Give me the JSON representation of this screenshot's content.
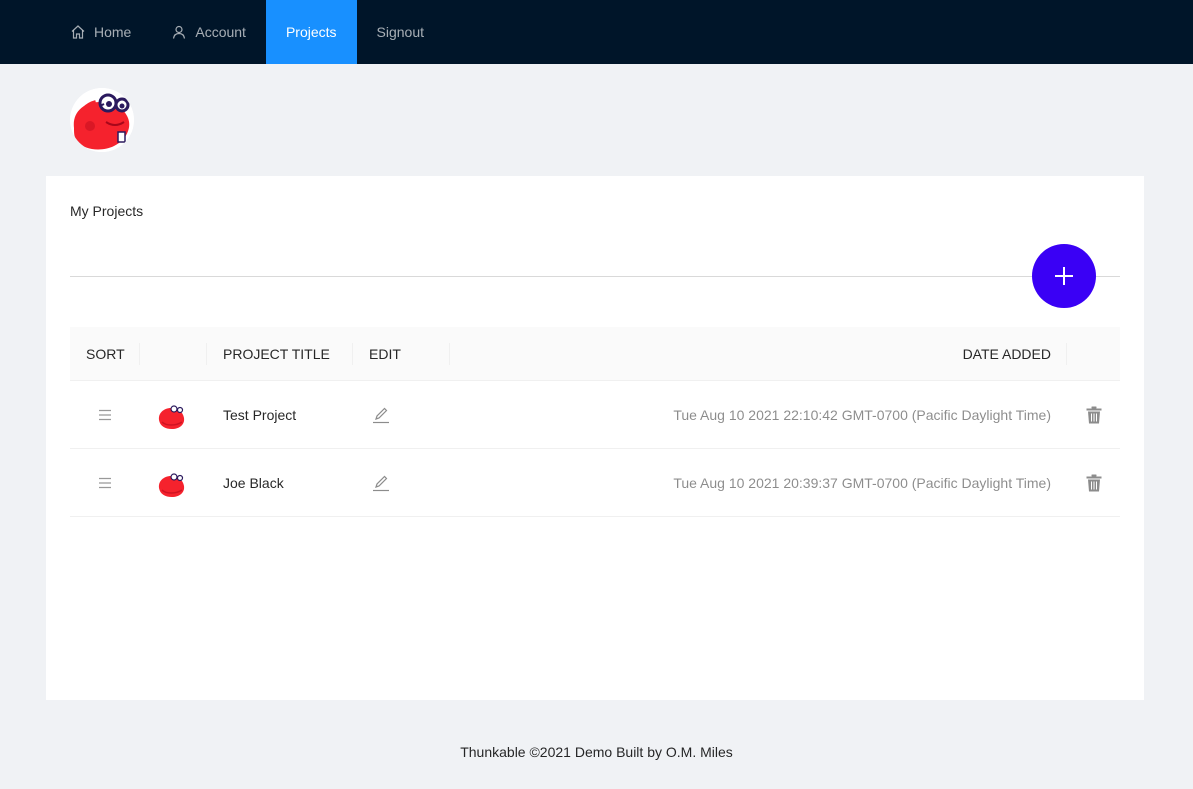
{
  "nav": {
    "items": [
      {
        "label": "Home",
        "icon": "home-icon"
      },
      {
        "label": "Account",
        "icon": "user-icon"
      },
      {
        "label": "Projects",
        "icon": "",
        "active": true
      },
      {
        "label": "Signout",
        "icon": ""
      }
    ]
  },
  "colors": {
    "nav_bg": "#001529",
    "nav_active": "#1890ff",
    "fab": "#3a00f5",
    "mascot": "#f5222d"
  },
  "card": {
    "title": "My Projects"
  },
  "table": {
    "headers": {
      "sort": "SORT",
      "project_title": "PROJECT TITLE",
      "edit": "EDIT",
      "date_added": "DATE ADDED"
    },
    "rows": [
      {
        "title": "Test Project",
        "date": "Tue Aug 10 2021 22:10:42 GMT-0700 (Pacific Daylight Time)"
      },
      {
        "title": "Joe Black",
        "date": "Tue Aug 10 2021 20:39:37 GMT-0700 (Pacific Daylight Time)"
      }
    ]
  },
  "footer": {
    "text": "Thunkable ©2021 Demo Built by O.M. Miles"
  }
}
